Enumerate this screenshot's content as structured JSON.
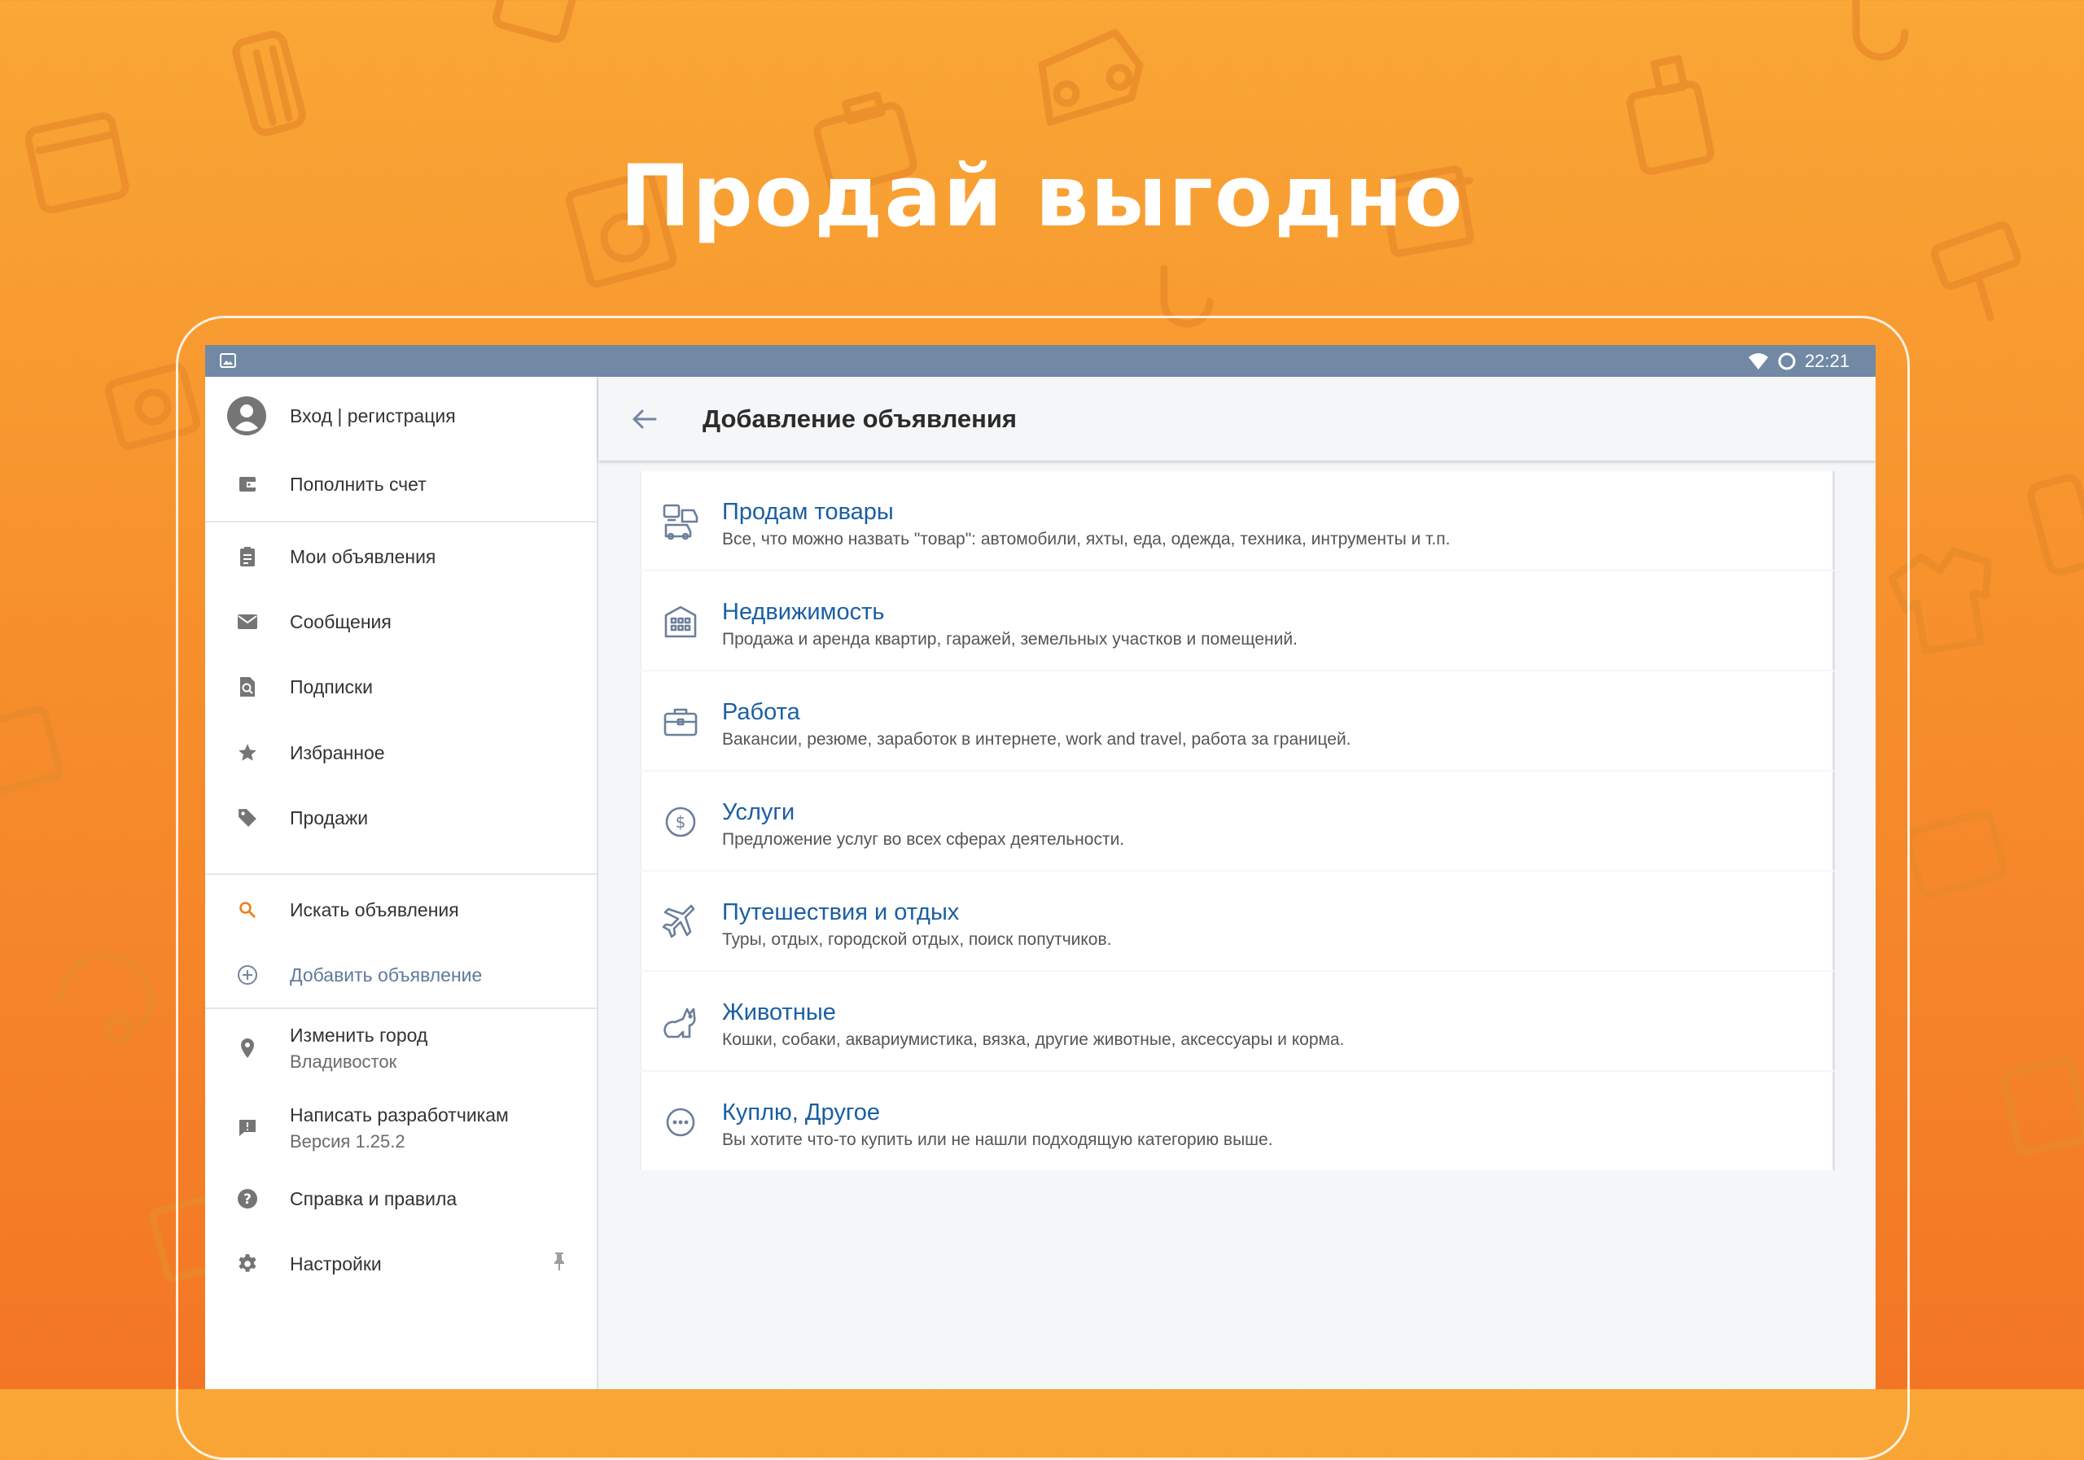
{
  "headline": "Продай выгодно",
  "status_bar": {
    "time": "22:21"
  },
  "drawer": {
    "account": "Вход | регистрация",
    "topup": "Пополнить счет",
    "items": [
      {
        "label": "Мои объявления"
      },
      {
        "label": "Сообщения"
      },
      {
        "label": "Подписки"
      },
      {
        "label": "Избранное"
      },
      {
        "label": "Продажи"
      }
    ],
    "search": "Искать объявления",
    "add": "Добавить объявление",
    "city_label": "Изменить город",
    "city_value": "Владивосток",
    "dev_label": "Написать разработчикам",
    "dev_version": "Версия 1.25.2",
    "help": "Справка и правила",
    "settings": "Настройки"
  },
  "appbar": {
    "title": "Добавление объявления"
  },
  "categories": [
    {
      "title": "Продам товары",
      "desc": "Все, что можно назвать \"товар\": автомобили, яхты, еда, одежда, техника, интрументы и т.п.",
      "icon": "goods-icon"
    },
    {
      "title": "Недвижимость",
      "desc": "Продажа и аренда квартир, гаражей, земельных участков и помещений.",
      "icon": "building-icon"
    },
    {
      "title": "Работа",
      "desc": "Вакансии, резюме, заработок в интернете, work and travel, работа за границей.",
      "icon": "briefcase-icon"
    },
    {
      "title": "Услуги",
      "desc": "Предложение услуг во всех сферах деятельности.",
      "icon": "dollar-coin-icon"
    },
    {
      "title": "Путешествия и отдых",
      "desc": "Туры, отдых, городской отдых, поиск попутчиков.",
      "icon": "airplane-icon"
    },
    {
      "title": "Животные",
      "desc": "Кошки, собаки, аквариумистика, вязка, другие животные, аксессуары и корма.",
      "icon": "cat-icon"
    },
    {
      "title": "Куплю, Другое",
      "desc": "Вы хотите что-то купить или не нашли подходящую категорию выше.",
      "icon": "more-dots-icon"
    }
  ],
  "colors": {
    "background_top": "#f9a736",
    "background_bottom": "#f37625",
    "status_bar": "#7189a5",
    "category_title": "#1a5fa3",
    "accent_orange": "#f07d1a"
  }
}
